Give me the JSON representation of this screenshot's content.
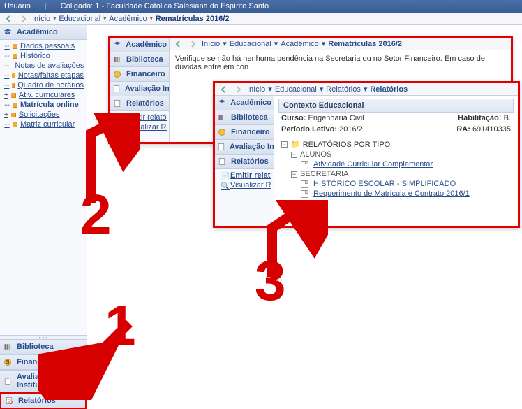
{
  "topbar": {
    "usuario_label": "Usuário",
    "coligada_label": "Coligada: 1 - Faculdade Católica Salesiana do Espírito Santo"
  },
  "breadcrumb": {
    "items": [
      "Início",
      "Educacional",
      "Acadêmico"
    ],
    "current": "Rematrículas 2016/2"
  },
  "sidebar": {
    "academico": {
      "label": "Acadêmico",
      "items": [
        "Dados pessoais",
        "Histórico",
        "Notas de avaliações",
        "Notas/faltas etapas",
        "Quadro de horários",
        "Ativ. curriculares",
        "Matrícula online",
        "Solicitações",
        "Matriz curricular"
      ]
    },
    "bottom": {
      "biblioteca": "Biblioteca",
      "financeiro": "Financeiro",
      "avaliacao": "Avaliação Instituci",
      "relatorios": "Relatórios"
    }
  },
  "popup1": {
    "bc": [
      "Início",
      "Educacional",
      "Acadêmico"
    ],
    "bc_current": "Rematrículas 2016/2",
    "side": {
      "academico": "Acadêmico",
      "biblioteca": "Biblioteca",
      "financeiro": "Financeiro",
      "avaliacao": "Avaliação Instituci",
      "relatorios": "Relatórios",
      "emitir": "Emitir relatórios",
      "visualizar": "Visualizar Relatório"
    },
    "message": "Verifique se não há nenhuma pendência na Secretaria ou no Setor Financeiro. Em caso de dúvidas entre em con"
  },
  "popup2": {
    "bc": [
      "Início",
      "Educacional",
      "Relatórios"
    ],
    "bc_current": "Relatórios",
    "side": {
      "academico": "Acadêmico",
      "biblioteca": "Biblioteca",
      "financeiro": "Financeiro",
      "avaliacao": "Avaliação Instituci",
      "relatorios": "Relatórios",
      "emitir": "Emitir relatórios",
      "visualizar": "Visualizar Relatório"
    },
    "ctx_header": "Contexto Educacional",
    "curso_label": "Curso:",
    "curso_value": "Engenharia Civil",
    "periodo_label": "Período Letivo:",
    "periodo_value": "2016/2",
    "habilitacao_label": "Habilitação:",
    "habilitacao_value": "B.",
    "ra_label": "RA:",
    "ra_value": "691410335",
    "tree": {
      "root": "RELATÓRIOS POR TIPO",
      "alunos": "ALUNOS",
      "alunos_items": [
        "Atividade Curricular Complementar"
      ],
      "secretaria": "SECRETARIA",
      "secretaria_items": [
        "HISTÓRICO ESCOLAR - SIMPLIFICADO",
        "Requerimento de Matrícula e Contrato 2016/1"
      ]
    }
  },
  "annotations": {
    "n1": "1",
    "n2": "2",
    "n3": "3"
  }
}
